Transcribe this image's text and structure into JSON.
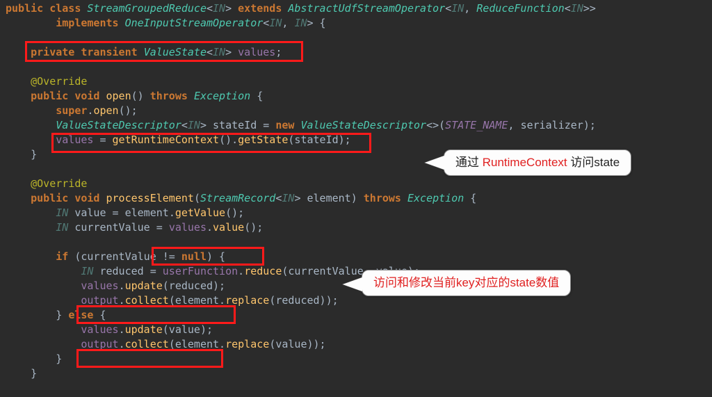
{
  "code": {
    "l1": {
      "public": "public",
      "class": "class",
      "name": "StreamGroupedReduce",
      "lt": "<",
      "in": "IN",
      "gt": ">",
      "extends": "extends",
      "sup": "AbstractUdfStreamOperator",
      "lt2": "<",
      "in2": "IN",
      "comma": ", ",
      "rf": "ReduceFunction",
      "lt3": "<",
      "in3": "IN",
      "gt3": ">",
      "gt2": ">>"
    },
    "l2": {
      "implements": "implements",
      "iface": "OneInputStreamOperator",
      "lt": "<",
      "in": "IN",
      "comma": ", ",
      "in2": "IN",
      "gt": ">",
      "brace": " {"
    },
    "l3": {
      "private": "private",
      "transient": "transient",
      "type": "ValueState",
      "lt": "<",
      "in": "IN",
      "gt": ">",
      "name": " values",
      "semi": ";"
    },
    "l4": {
      "ann": "@Override"
    },
    "l5": {
      "public": "public",
      "void": "void",
      "name": " open",
      "paren": "()",
      "throws": "throws",
      "ex": "Exception",
      "brace": " {"
    },
    "l6": {
      "super": "super",
      "dot": ".",
      "open": "open",
      "paren": "();"
    },
    "l7": {
      "type": "ValueStateDescriptor",
      "lt": "<",
      "in": "IN",
      "gt": ">",
      "name": " stateId ",
      "eq": "= ",
      "new": "new",
      "type2": " ValueStateDescriptor",
      "diamond": "<>",
      "paren": "(",
      "const": "STATE_NAME",
      "comma": ", ",
      "arg": "serializer",
      "paren2": ");"
    },
    "l8": {
      "lhs": "values",
      "eq": " = ",
      "fn1": "getRuntimeContext",
      "p1": "().",
      "fn2": "getState",
      "p2": "(stateId);"
    },
    "l9": {
      "brace": "}"
    },
    "l10": {
      "ann": "@Override"
    },
    "l11": {
      "public": "public",
      "void": "void",
      "name": " processElement",
      "paren": "(",
      "type": "StreamRecord",
      "lt": "<",
      "in": "IN",
      "gt": ">",
      "arg": " element",
      "paren2": ")",
      "throws": "throws",
      "ex": "Exception",
      "brace": " {"
    },
    "l12": {
      "type": "IN",
      "name": " value ",
      "eq": "= ",
      "obj": "element",
      "dot": ".",
      "fn": "getValue",
      "paren": "();"
    },
    "l13": {
      "type": "IN",
      "name": " currentValue ",
      "eq": "= ",
      "obj": "values",
      "dot": ".",
      "fn": "value",
      "paren": "();"
    },
    "l14": {
      "if": "if",
      "paren": " (currentValue ",
      "neq": "!= ",
      "null": "null",
      "paren2": ") {"
    },
    "l15": {
      "type": "IN",
      "name": " reduced ",
      "eq": "= ",
      "obj": "userFunction",
      "dot": ".",
      "fn": "reduce",
      "paren": "(currentValue, value);"
    },
    "l16": {
      "obj": "values",
      "dot": ".",
      "fn": "update",
      "paren": "(reduced);"
    },
    "l17": {
      "obj": "output",
      "dot": ".",
      "fn": "collect",
      "paren": "(element.",
      "fn2": "replace",
      "paren2": "(reduced));"
    },
    "l18": {
      "brace": "} ",
      "else": "else",
      "brace2": " {"
    },
    "l19": {
      "obj": "values",
      "dot": ".",
      "fn": "update",
      "paren": "(value);"
    },
    "l20": {
      "obj": "output",
      "dot": ".",
      "fn": "collect",
      "paren": "(element.",
      "fn2": "replace",
      "paren2": "(value));"
    },
    "l21": {
      "brace": "}"
    },
    "l22": {
      "brace": "}"
    }
  },
  "callouts": {
    "c1_pre": "通过 ",
    "c1_red": "RuntimeContext",
    "c1_post": " 访问state",
    "c2": "访问和修改当前key对应的state数值"
  }
}
